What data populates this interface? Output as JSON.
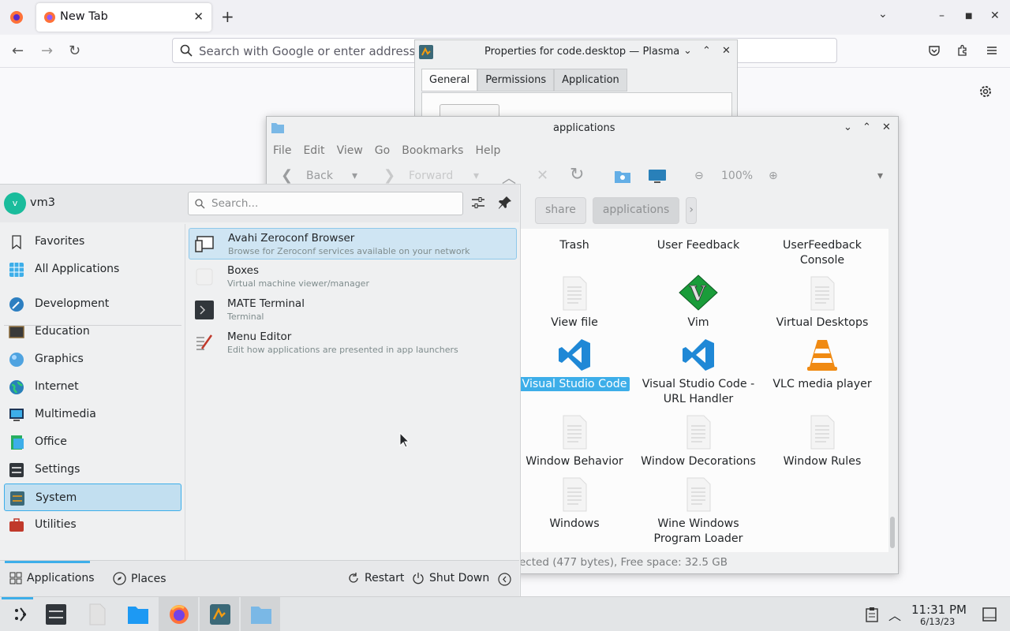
{
  "firefox": {
    "tab_title": "New Tab",
    "url_placeholder": "Search with Google or enter address"
  },
  "properties_dialog": {
    "title": "Properties for code.desktop — Plasma",
    "tabs": [
      "General",
      "Permissions",
      "Application"
    ]
  },
  "dolphin": {
    "title": "applications",
    "menu": [
      "File",
      "Edit",
      "View",
      "Go",
      "Bookmarks",
      "Help"
    ],
    "toolbar": {
      "back": "Back",
      "forward": "Forward",
      "zoom": "100%"
    },
    "breadcrumbs": [
      "share",
      "applications"
    ],
    "files": [
      {
        "name": "Trash",
        "icon": "trash-icon"
      },
      {
        "name": "User Feedback",
        "icon": "feedback-icon"
      },
      {
        "name": "UserFeedback Console",
        "icon": "feedback-console-icon"
      },
      {
        "name": "View file",
        "icon": "file-icon"
      },
      {
        "name": "Vim",
        "icon": "vim-icon"
      },
      {
        "name": "Virtual Desktops",
        "icon": "file-icon"
      },
      {
        "name": "Visual Studio Code",
        "icon": "vscode-icon",
        "selected": true
      },
      {
        "name": "Visual Studio Code - URL Handler",
        "icon": "vscode-icon"
      },
      {
        "name": "VLC media player",
        "icon": "vlc-icon"
      },
      {
        "name": "Window Behavior",
        "icon": "file-icon"
      },
      {
        "name": "Window Decorations",
        "icon": "file-icon"
      },
      {
        "name": "Window Rules",
        "icon": "file-icon"
      },
      {
        "name": "Windows",
        "icon": "file-icon"
      },
      {
        "name": "Wine Windows Program Loader",
        "icon": "file-icon"
      }
    ],
    "status": "ected (477 bytes), Free space: 32.5 GB"
  },
  "kickoff": {
    "user": "vm3",
    "avatar_letter": "v",
    "search_placeholder": "Search...",
    "categories": [
      {
        "label": "Favorites",
        "icon": "bookmark-icon"
      },
      {
        "label": "All Applications",
        "icon": "grid-icon"
      },
      {
        "label": "Development",
        "icon": "development-icon"
      },
      {
        "label": "Education",
        "icon": "education-icon"
      },
      {
        "label": "Graphics",
        "icon": "graphics-icon"
      },
      {
        "label": "Internet",
        "icon": "globe-icon"
      },
      {
        "label": "Multimedia",
        "icon": "multimedia-icon"
      },
      {
        "label": "Office",
        "icon": "office-icon"
      },
      {
        "label": "Settings",
        "icon": "settings-icon"
      },
      {
        "label": "System",
        "icon": "system-icon",
        "active": true
      },
      {
        "label": "Utilities",
        "icon": "utilities-icon"
      }
    ],
    "apps": [
      {
        "name": "Avahi Zeroconf Browser",
        "desc": "Browse for Zeroconf services available on your network"
      },
      {
        "name": "Boxes",
        "desc": "Virtual machine viewer/manager"
      },
      {
        "name": "MATE Terminal",
        "desc": "Terminal"
      },
      {
        "name": "Menu Editor",
        "desc": "Edit how applications are presented in app launchers"
      }
    ],
    "footer": {
      "applications": "Applications",
      "places": "Places",
      "restart": "Restart",
      "shutdown": "Shut Down"
    }
  },
  "taskbar": {
    "time": "11:31 PM",
    "date": "6/13/23"
  },
  "colors": {
    "accent": "#3daee9",
    "selection_bg": "#c2dff0"
  }
}
